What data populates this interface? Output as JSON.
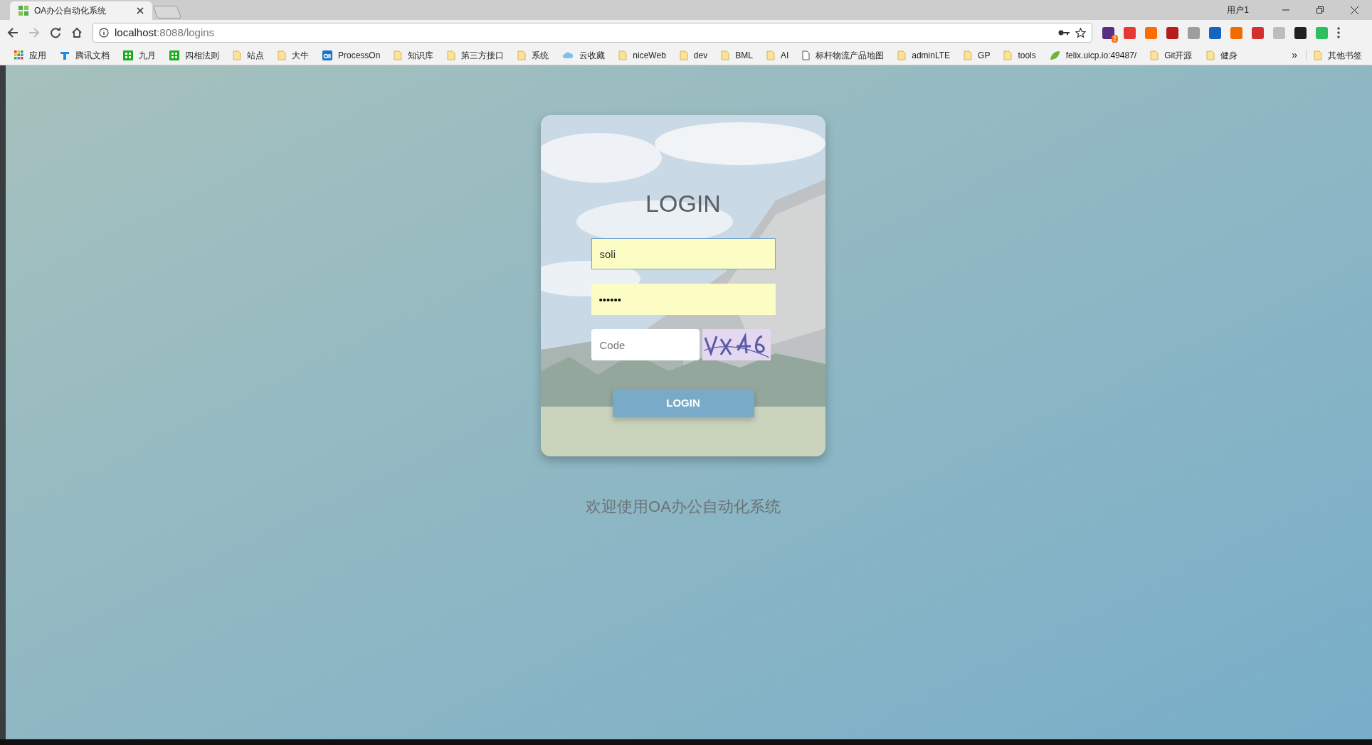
{
  "browser": {
    "tab": {
      "title": "OA办公自动化系统"
    },
    "profile": "用户1",
    "address": {
      "host": "localhost",
      "rest": ":8088/logins"
    },
    "extension_badge": "2",
    "bookmarks": [
      {
        "label": "应用",
        "kind": "apps"
      },
      {
        "label": "腾讯文档",
        "kind": "doc"
      },
      {
        "label": "九月",
        "kind": "sheet"
      },
      {
        "label": "四相法则",
        "kind": "sheet"
      },
      {
        "label": "站点",
        "kind": "folder"
      },
      {
        "label": "大牛",
        "kind": "folder"
      },
      {
        "label": "ProcessOn",
        "kind": "on"
      },
      {
        "label": "知识库",
        "kind": "folder"
      },
      {
        "label": "第三方接口",
        "kind": "folder"
      },
      {
        "label": "系统",
        "kind": "folder"
      },
      {
        "label": "云收藏",
        "kind": "cloud"
      },
      {
        "label": "niceWeb",
        "kind": "folder"
      },
      {
        "label": "dev",
        "kind": "folder"
      },
      {
        "label": "BML",
        "kind": "folder"
      },
      {
        "label": "AI",
        "kind": "folder"
      },
      {
        "label": "标杆物流产品地图",
        "kind": "page"
      },
      {
        "label": "adminLTE",
        "kind": "folder"
      },
      {
        "label": "GP",
        "kind": "folder"
      },
      {
        "label": "tools",
        "kind": "folder"
      },
      {
        "label": "felix.uicp.io:49487/",
        "kind": "leaf"
      },
      {
        "label": "Git开源",
        "kind": "folder"
      },
      {
        "label": "健身",
        "kind": "folder"
      }
    ],
    "more_bookmarks": "»",
    "other_bookmarks": "其他书签"
  },
  "login": {
    "title": "LOGIN",
    "username": "soli",
    "password": "••••••",
    "code_placeholder": "Code",
    "button": "LOGIN"
  },
  "welcome": "欢迎使用OA办公自动化系统"
}
